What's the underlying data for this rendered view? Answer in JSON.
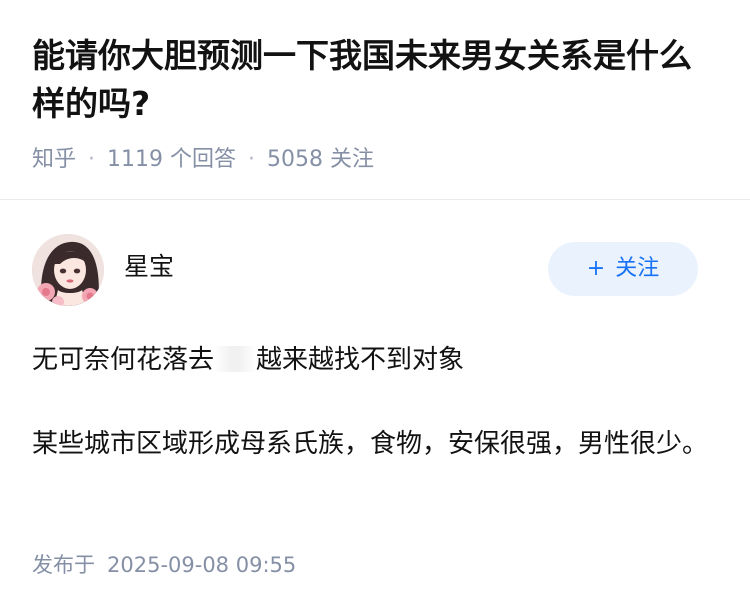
{
  "question": {
    "title": "能请你大胆预测一下我国未来男女关系是什么样的吗?",
    "source": "知乎",
    "answer_count": "1119",
    "answer_label": "个回答",
    "follower_count": "5058",
    "follower_label": "关注"
  },
  "answer": {
    "author_name": "星宝",
    "follow_button": "关注",
    "paragraphs": [
      {
        "part1": "无可奈何花落去",
        "part2": "越来越找不到对象"
      },
      {
        "text": "某些城市区域形成母系氏族，食物，安保很强，男性很少。"
      }
    ],
    "published_label": "发布于",
    "published_time": "2025-09-08 09:55"
  },
  "icons": {
    "follow": "plus-icon",
    "avatar": "avatar-illustration-woman"
  },
  "colors": {
    "accent": "#1772f6",
    "button_bg": "#eaf2fe",
    "meta_text": "#8590a6",
    "text": "#121212"
  }
}
